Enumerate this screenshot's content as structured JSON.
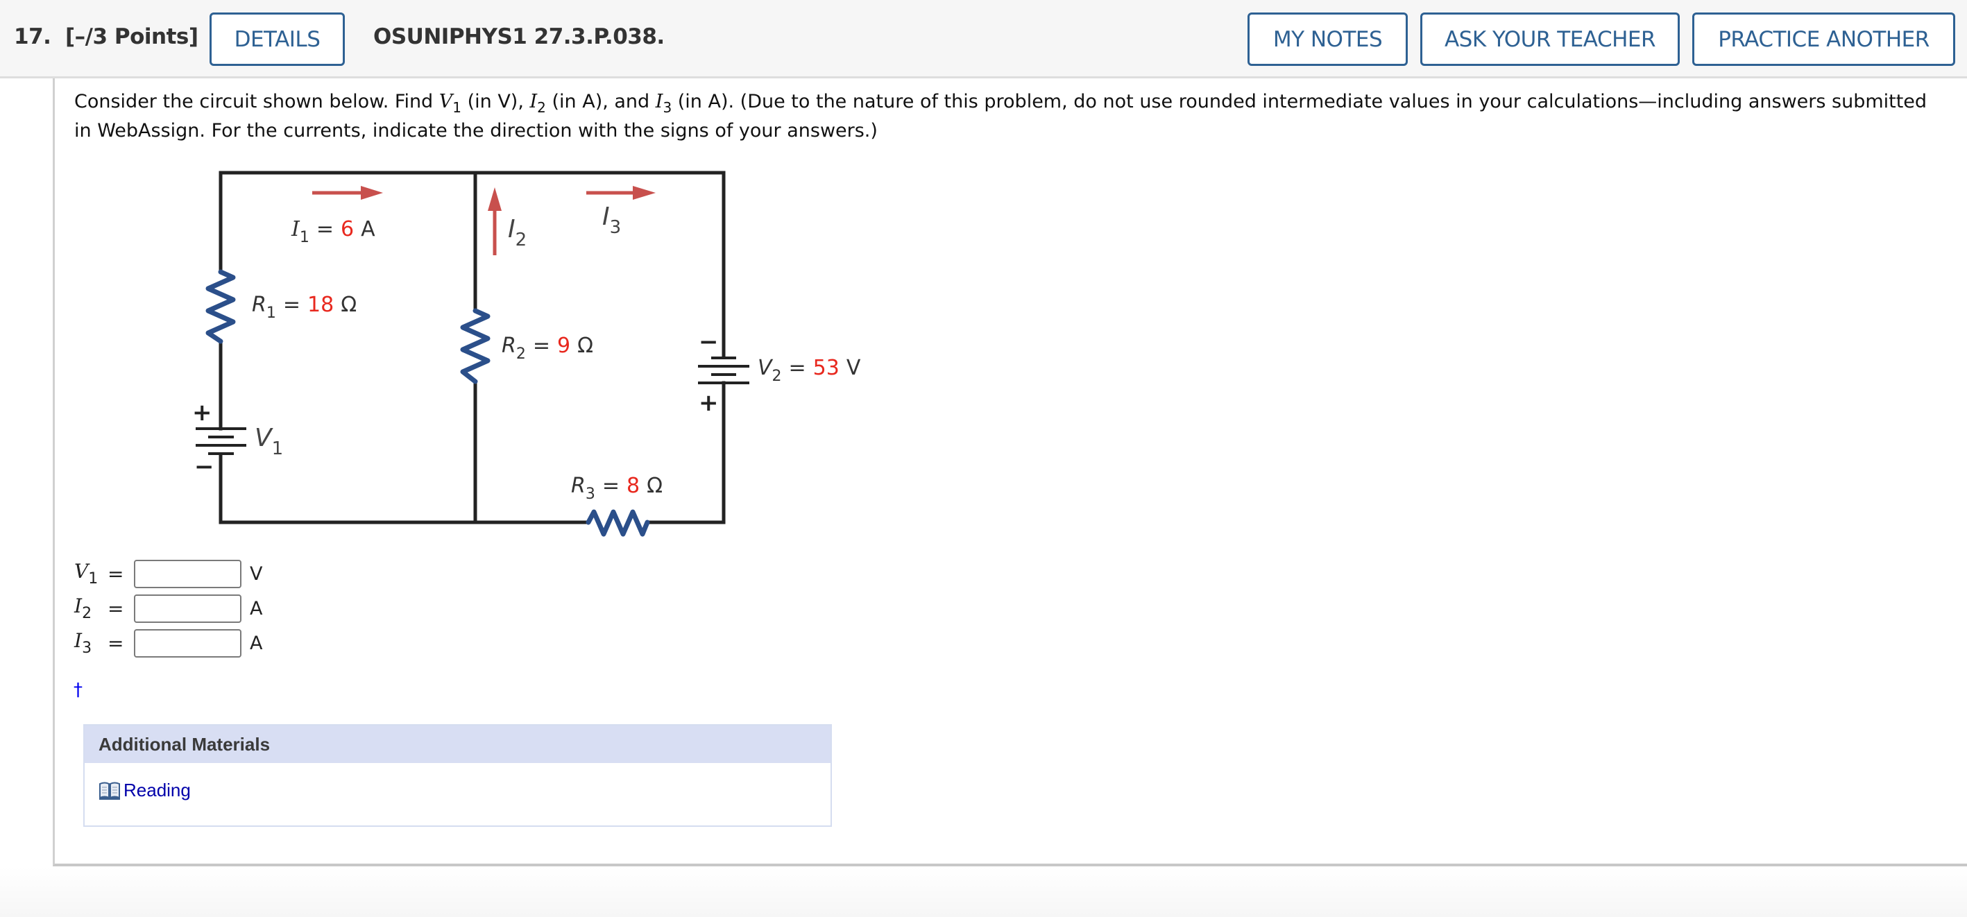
{
  "header": {
    "question_number": "17.",
    "points": "[–/3 Points]",
    "details_button": "DETAILS",
    "problem_id": "OSUNIPHYS1 27.3.P.038.",
    "my_notes_button": "MY NOTES",
    "ask_teacher_button": "ASK YOUR TEACHER",
    "practice_another_button": "PRACTICE ANOTHER",
    "button_color": "#2e6193"
  },
  "question": {
    "text_1": "Consider the circuit shown below. Find ",
    "v1_sym": "V",
    "v1_sub": "1",
    "text_2": " (in V), ",
    "i2_sym": "I",
    "i2_sub": "2",
    "text_3": " (in A), and ",
    "i3_sym": "I",
    "i3_sub": "3",
    "text_4": " (in A). (Due to the nature of this problem, do not use rounded intermediate values in your calculations—including answers submitted in WebAssign. For the currents, indicate the direction with the signs of your answers.)"
  },
  "circuit": {
    "i1": {
      "symbol": "I",
      "sub": "1",
      "eq": "=",
      "value": "6",
      "unit": "A"
    },
    "r1": {
      "symbol": "R",
      "sub": "1",
      "eq": "=",
      "value": "18",
      "unit": "Ω"
    },
    "r2": {
      "symbol": "R",
      "sub": "2",
      "eq": "=",
      "value": "9",
      "unit": "Ω"
    },
    "r3": {
      "symbol": "R",
      "sub": "3",
      "eq": "=",
      "value": "8",
      "unit": "Ω"
    },
    "v1": {
      "symbol": "V",
      "sub": "1"
    },
    "v2": {
      "symbol": "V",
      "sub": "2",
      "eq": "=",
      "value": "53",
      "unit": "V"
    },
    "i2": {
      "symbol": "I",
      "sub": "2"
    },
    "i3": {
      "symbol": "I",
      "sub": "3"
    },
    "plus": "+",
    "minus": "−",
    "value_color": "#e8281e",
    "resistor_color": "#2b4f8a",
    "arrow_color": "#c8504d",
    "wire_color": "#222222"
  },
  "answers": [
    {
      "symbol": "V",
      "sub": "1",
      "eq": "=",
      "value": "",
      "unit": "V"
    },
    {
      "symbol": "I",
      "sub": "2",
      "eq": "=",
      "value": "",
      "unit": "A"
    },
    {
      "symbol": "I",
      "sub": "3",
      "eq": "=",
      "value": "",
      "unit": "A"
    }
  ],
  "dagger": "†",
  "additional_materials": {
    "title": "Additional Materials",
    "reading_link": "Reading"
  }
}
